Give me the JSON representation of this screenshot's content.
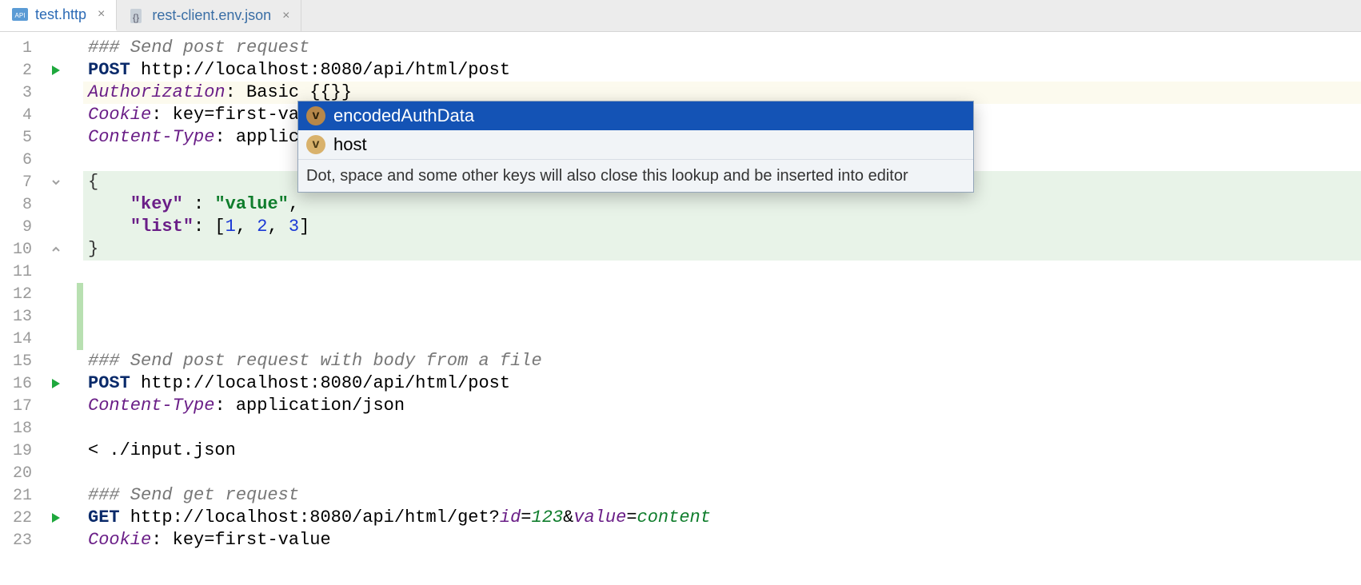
{
  "tabs": [
    {
      "label": "test.http",
      "active": true,
      "icon": "api-icon"
    },
    {
      "label": "rest-client.env.json",
      "active": false,
      "icon": "json-icon"
    }
  ],
  "gutter": {
    "lines": [
      "1",
      "2",
      "3",
      "4",
      "5",
      "6",
      "7",
      "8",
      "9",
      "10",
      "11",
      "12",
      "13",
      "14",
      "15",
      "16",
      "17",
      "18",
      "19",
      "20",
      "21",
      "22",
      "23"
    ],
    "run_lines": [
      2,
      16,
      22
    ],
    "fold_open_lines": [
      7
    ],
    "fold_close_lines": [
      10
    ]
  },
  "highlight": {
    "current_line_index": 2,
    "block_start": 6,
    "block_end": 9
  },
  "code": {
    "l1_comment": "### Send post request",
    "l2_method": "POST",
    "l2_url": " http://localhost:8080/api/html/post",
    "l3_header": "Authorization",
    "l3_rest": ": Basic {{}}",
    "l4_header": "Cookie",
    "l4_rest": ": key=first-va",
    "l5_header": "Content-Type",
    "l5_rest": ": applic",
    "l7_brace": "{",
    "l8_key": "\"key\"",
    "l8_colon": " : ",
    "l8_val": "\"value\"",
    "l8_comma": ",",
    "l9_key": "\"list\"",
    "l9_colon": ": [",
    "l9_n1": "1",
    "l9_s1": ", ",
    "l9_n2": "2",
    "l9_s2": ", ",
    "l9_n3": "3",
    "l9_close": "]",
    "l10_brace": "}",
    "l15_comment": "### Send post request with body from a file",
    "l16_method": "POST",
    "l16_url": " http://localhost:8080/api/html/post",
    "l17_header": "Content-Type",
    "l17_rest": ": application/json",
    "l19_text": "< ./input.json",
    "l21_comment": "### Send get request",
    "l22_method": "GET",
    "l22_url_a": " http://localhost:8080/api/html/get?",
    "l22_p1": "id",
    "l22_eq1": "=",
    "l22_v1": "123",
    "l22_amp": "&",
    "l22_p2": "value",
    "l22_eq2": "=",
    "l22_v2": "content",
    "l23_header": "Cookie",
    "l23_rest": ": key=first-value"
  },
  "autocomplete": {
    "items": [
      {
        "badge": "v",
        "label": "encodedAuthData",
        "selected": true
      },
      {
        "badge": "v",
        "label": "host",
        "selected": false
      }
    ],
    "hint": "Dot, space and some other keys will also close this lookup and be inserted into editor"
  }
}
